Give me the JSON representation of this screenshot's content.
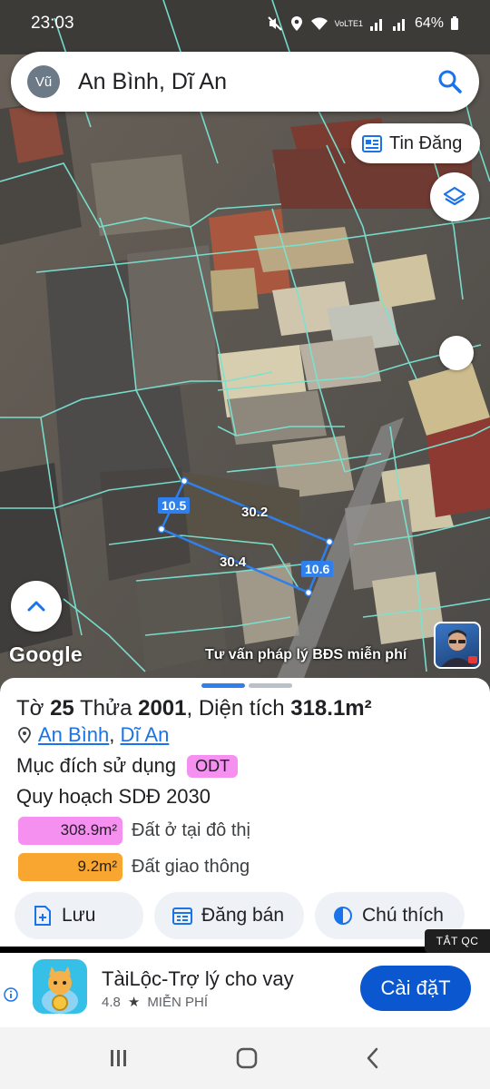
{
  "status_bar": {
    "time": "23:03",
    "battery": "64%",
    "net_label": "VoLTE1"
  },
  "search": {
    "avatar": "Vũ",
    "query": "An Bình, Dĩ An"
  },
  "map": {
    "tin_dang_label": "Tin Đăng",
    "google_label": "Google",
    "advice_label": "Tư vấn pháp lý BĐS miễn phí",
    "measurements": {
      "left": "10.5",
      "top": "30.2",
      "bottom": "30.4",
      "right": "10.6"
    },
    "accent": "#2f80ed",
    "parcel_line_color": "#79e3d2"
  },
  "parcel": {
    "to_label": "Tờ",
    "to_value": "25",
    "thua_label": "Thửa",
    "thua_value": "2001",
    "dien_tich_label": "Diện tích",
    "dien_tich_value": "318.1m²",
    "location_ward": "An Bình",
    "location_sep": ",",
    "location_city": "Dĩ An",
    "purpose_label": "Mục đích sử dụng",
    "purpose_tag": "ODT",
    "plan_label": "Quy hoạch SDĐ 2030",
    "areas": [
      {
        "value": "308.9m²",
        "label": "Đất ở tại đô thị",
        "color": "#f58ff0"
      },
      {
        "value": "9.2m²",
        "label": "Đất giao thông",
        "color": "#f9a630"
      }
    ]
  },
  "actions": [
    {
      "label": "Lưu",
      "icon": "save-add-icon"
    },
    {
      "label": "Đăng bán",
      "icon": "calendar-list-icon"
    },
    {
      "label": "Chú thích",
      "icon": "legend-icon"
    }
  ],
  "ad": {
    "close_label": "TẮT QC",
    "app_name": "TàiLộc-Trợ lý cho vay",
    "rating": "4.8",
    "price": "MIỄN PHÍ",
    "install_label": "Cài đặT"
  }
}
